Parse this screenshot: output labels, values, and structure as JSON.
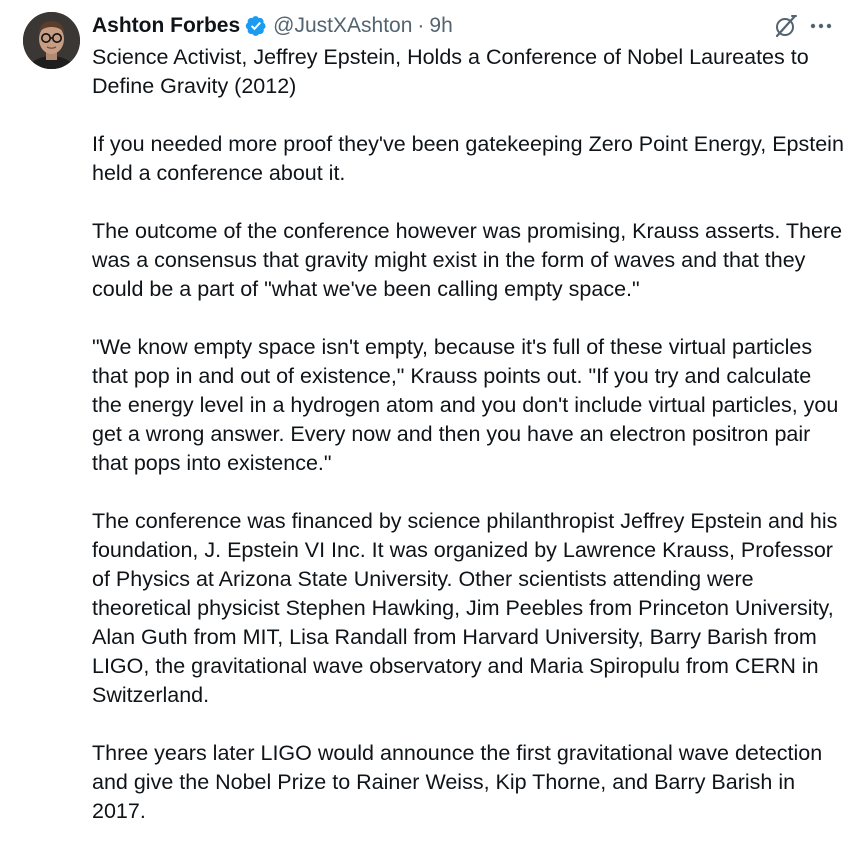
{
  "author": {
    "display_name": "Ashton Forbes",
    "handle": "@JustXAshton",
    "separator": "·",
    "time": "9h",
    "verified_icon": "verified-badge-icon",
    "verified_color": "#1d9bf0"
  },
  "actions": {
    "grok_icon": "grok-icon",
    "more_icon": "more-options-icon"
  },
  "post": {
    "paragraphs": [
      "Science Activist, Jeffrey Epstein, Holds a Conference of Nobel Laureates to Define Gravity (2012)",
      "If you needed more proof they've been gatekeeping Zero Point Energy, Epstein held a conference about it.",
      "The outcome of the conference however was promising, Krauss asserts. There was a consensus that gravity might exist in the form of waves and that they could be a part of \"what we've been calling empty space.\"",
      "\"We know empty space isn't empty, because it's full of these virtual particles that pop in and out of existence,\" Krauss points out. \"If you try and calculate the energy level in a hydrogen atom and you don't include virtual particles, you get a wrong answer. Every now and then you have an electron positron pair that pops into existence.\"",
      "The conference was financed by science philanthropist Jeffrey Epstein and his foundation, J. Epstein VI Inc. It was organized by Lawrence Krauss, Professor of Physics at Arizona State University. Other scientists attending were theoretical physicist Stephen Hawking, Jim Peebles from Princeton University, Alan Guth from MIT, Lisa Randall from Harvard University, Barry Barish from LIGO, the gravitational wave observatory and Maria Spiropulu from CERN in Switzerland.",
      "Three years later LIGO would announce the first gravitational wave detection and give the Nobel Prize to Rainer Weiss, Kip Thorne, and Barry Barish in 2017."
    ]
  }
}
